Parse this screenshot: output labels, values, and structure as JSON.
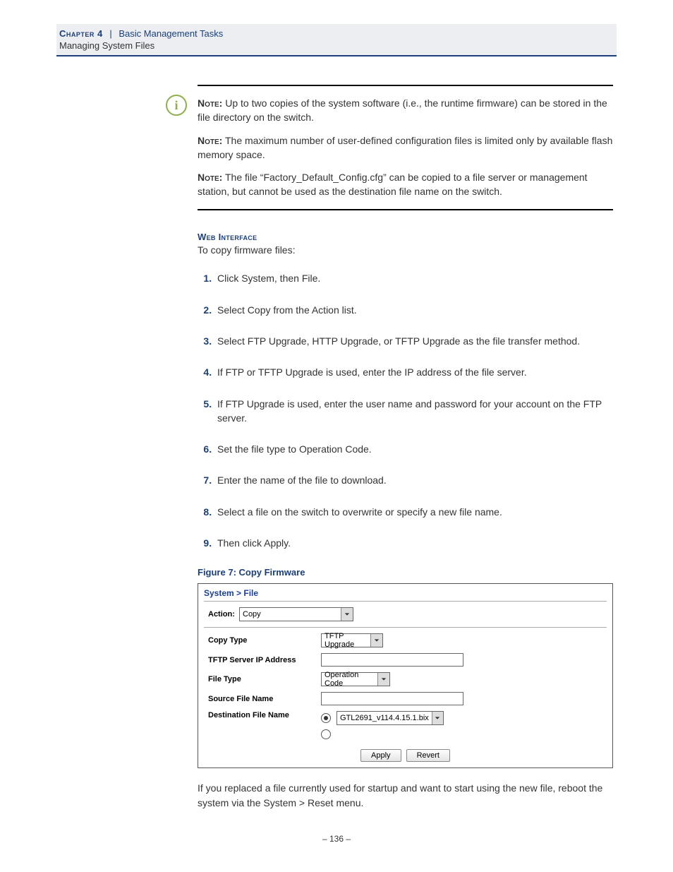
{
  "header": {
    "chapter": "Chapter 4",
    "title": "Basic Management Tasks",
    "subtitle": "Managing System Files"
  },
  "notes": {
    "label": "Note:",
    "items": [
      "Up to two copies of the system software (i.e., the runtime firmware) can be stored in the file directory on the switch.",
      "The maximum number of user-defined configuration files is limited only by available flash memory space.",
      "The file “Factory_Default_Config.cfg” can be copied to a file server or management station, but cannot be used as the destination file name on the switch."
    ]
  },
  "section": {
    "heading": "Web Interface",
    "intro": "To copy firmware files:",
    "steps": [
      "Click System, then File.",
      "Select Copy from the Action list.",
      "Select FTP Upgrade, HTTP Upgrade, or TFTP Upgrade as the file transfer method.",
      "If FTP or TFTP Upgrade is used, enter the IP address of the file server.",
      "If FTP Upgrade is used, enter the user name and password for your account on the FTP server.",
      "Set the file type to Operation Code.",
      "Enter the name of the file to download.",
      "Select a file on the switch to overwrite or specify a new file name.",
      "Then click Apply."
    ]
  },
  "figure": {
    "caption": "Figure 7:  Copy Firmware",
    "ui": {
      "breadcrumb": "System > File",
      "action_label": "Action:",
      "action_value": "Copy",
      "rows": {
        "copy_type": {
          "label": "Copy Type",
          "value": "TFTP Upgrade"
        },
        "server_ip": {
          "label": "TFTP Server IP Address",
          "value": ""
        },
        "file_type": {
          "label": "File Type",
          "value": "Operation Code"
        },
        "source": {
          "label": "Source File Name",
          "value": ""
        },
        "dest": {
          "label": "Destination File Name",
          "value": "GTL2691_v114.4.15.1.bix"
        }
      },
      "buttons": {
        "apply": "Apply",
        "revert": "Revert"
      }
    }
  },
  "after_text": "If you replaced a file currently used for startup and want to start using the new file, reboot the system via the System > Reset menu.",
  "footer": "–  136  –"
}
